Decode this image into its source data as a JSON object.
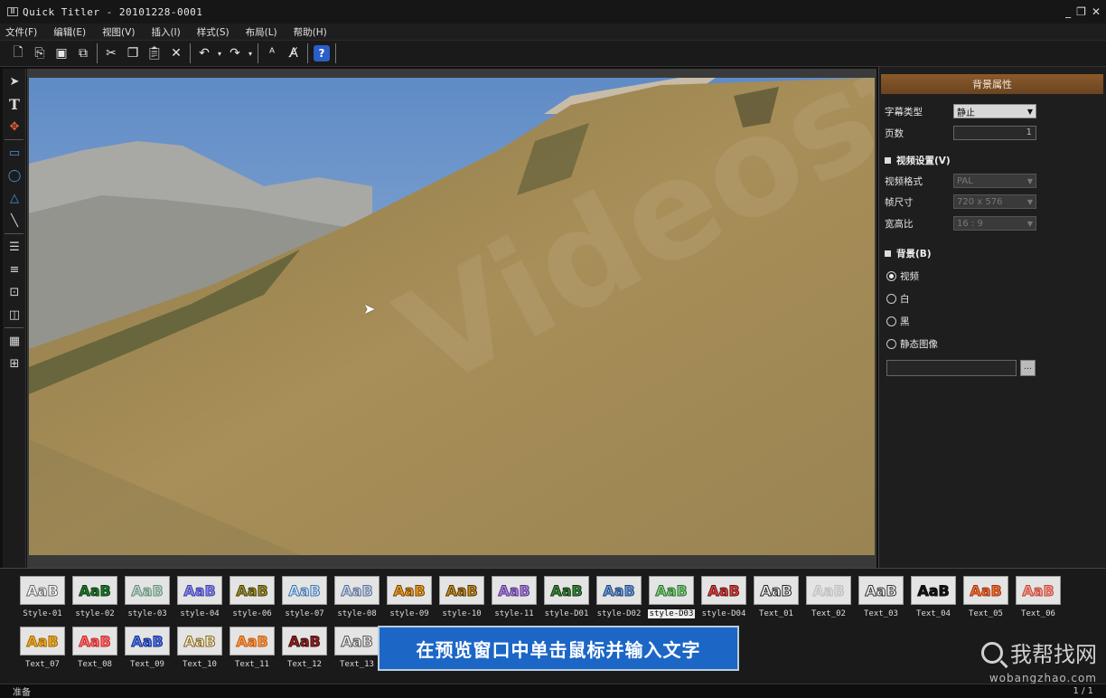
{
  "window": {
    "title": "Quick Titler - 20101228-0001",
    "controls": [
      "_",
      "❐",
      "✕"
    ]
  },
  "menu": [
    "文件(F)",
    "编辑(E)",
    "视图(V)",
    "插入(I)",
    "样式(S)",
    "布局(L)",
    "帮助(H)"
  ],
  "toolbar": {
    "icons": [
      "new-file-icon",
      "open-file-icon",
      "save-icon",
      "save-all-icon",
      "cut-icon",
      "copy-icon",
      "paste-icon",
      "delete-icon",
      "undo-icon",
      "redo-icon",
      "text-style-icon",
      "text-edit-icon",
      "help-icon"
    ],
    "help_label": "?"
  },
  "left_tools": [
    "select-arrow-icon",
    "text-tool-icon",
    "move-tool-icon",
    "rectangle-icon",
    "ellipse-icon",
    "triangle-icon",
    "line-icon",
    "align-icon",
    "distribute-icon",
    "center-icon",
    "layer-icon",
    "grid-icon",
    "safe-area-icon"
  ],
  "props": {
    "header": "背景属性",
    "caption_type_label": "字幕类型",
    "caption_type_value": "静止",
    "pages_label": "页数",
    "pages_value": "1",
    "video_section": "视频设置(V)",
    "video_format_label": "视频格式",
    "video_format_value": "PAL",
    "frame_size_label": "帧尺寸",
    "frame_size_value": "720 x 576",
    "aspect_label": "宽高比",
    "aspect_value": "16 : 9",
    "bg_section": "背景(B)",
    "bg_options": [
      "视频",
      "白",
      "黑",
      "静态图像"
    ],
    "bg_selected": 0,
    "browse_label": "..."
  },
  "styles_row1": [
    {
      "name": "Style-01",
      "text": "AaB",
      "color": "#ffffff",
      "stroke": "#666666"
    },
    {
      "name": "style-02",
      "text": "AaB",
      "color": "#1f7a2a",
      "stroke": "#0b3a10"
    },
    {
      "name": "style-03",
      "text": "AaB",
      "color": "#b8d8c8",
      "stroke": "#6a8a7a"
    },
    {
      "name": "style-04",
      "text": "AaB",
      "color": "#8a8af0",
      "stroke": "#3a3aa0"
    },
    {
      "name": "style-06",
      "text": "AaB",
      "color": "#a09020",
      "stroke": "#403a10"
    },
    {
      "name": "style-07",
      "text": "AaB",
      "color": "#d0e8ff",
      "stroke": "#4070a0"
    },
    {
      "name": "style-08",
      "text": "AaB",
      "color": "#c8d8f0",
      "stroke": "#5a6a8a"
    },
    {
      "name": "style-09",
      "text": "AaB",
      "color": "#f0a020",
      "stroke": "#704000"
    },
    {
      "name": "style-10",
      "text": "AaB",
      "color": "#c89020",
      "stroke": "#503000"
    },
    {
      "name": "style-11",
      "text": "AaB",
      "color": "#b080e0",
      "stroke": "#503080"
    },
    {
      "name": "style-D01",
      "text": "AaB",
      "color": "#3a8a3a",
      "stroke": "#103010"
    },
    {
      "name": "style-D02",
      "text": "AaB",
      "color": "#6a9ae0",
      "stroke": "#20406a"
    },
    {
      "name": "style-D03",
      "text": "AaB",
      "color": "#80d080",
      "stroke": "#2a6a2a"
    },
    {
      "name": "style-D04",
      "text": "AaB",
      "color": "#e04040",
      "stroke": "#601010"
    },
    {
      "name": "Text_01",
      "text": "AaB",
      "color": "#f4f4f4",
      "stroke": "#222222"
    },
    {
      "name": "Text_02",
      "text": "AaB",
      "color": "#dddddd",
      "stroke": "#bbbbbb"
    },
    {
      "name": "Text_03",
      "text": "AaB",
      "color": "#f4f4f4",
      "stroke": "#333333"
    },
    {
      "name": "Text_04",
      "text": "AaB",
      "color": "#111111",
      "stroke": "#111111"
    },
    {
      "name": "Text_05",
      "text": "AaB",
      "color": "#f07030",
      "stroke": "#a03010"
    },
    {
      "name": "Text_06",
      "text": "AaB",
      "color": "#f0a090",
      "stroke": "#c04030"
    }
  ],
  "styles_row2": [
    {
      "name": "Text_07",
      "text": "AaB",
      "color": "#f0b020",
      "stroke": "#a06000"
    },
    {
      "name": "Text_08",
      "text": "AaB",
      "color": "#ff7070",
      "stroke": "#c02020"
    },
    {
      "name": "Text_09",
      "text": "AaB",
      "color": "#5080f0",
      "stroke": "#102080"
    },
    {
      "name": "Text_10",
      "text": "AaB",
      "color": "#f8f0d0",
      "stroke": "#806020"
    },
    {
      "name": "Text_11",
      "text": "AaB",
      "color": "#f8a040",
      "stroke": "#c05010"
    },
    {
      "name": "Text_12",
      "text": "AaB",
      "color": "#902020",
      "stroke": "#401010"
    },
    {
      "name": "Text_13",
      "text": "AaB",
      "color": "#f0f0f0",
      "stroke": "#505050"
    }
  ],
  "selected_style": "style-D03",
  "banner": "在预览窗口中单击鼠标并输入文字",
  "watermark": {
    "main": "我帮找网",
    "sub": "wobangzhao.com"
  },
  "status": {
    "left": "准备",
    "right": "1 / 1"
  }
}
